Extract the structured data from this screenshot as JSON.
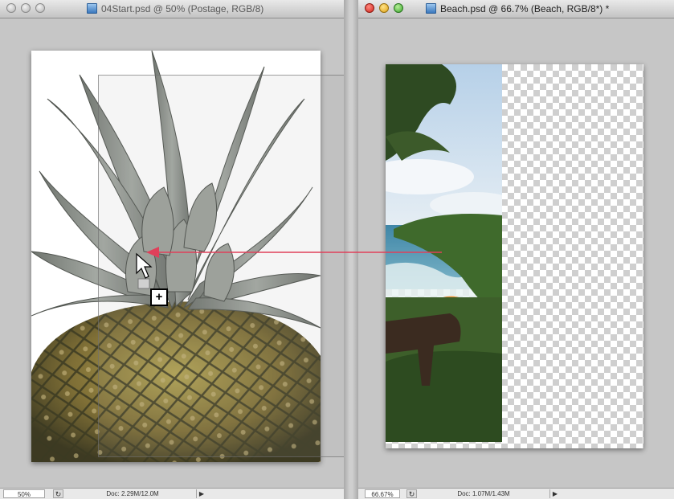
{
  "windows": {
    "left": {
      "title": "04Start.psd @ 50% (Postage, RGB/8)",
      "status": {
        "zoom": "50%",
        "doc": "Doc: 2.29M/12.0M"
      }
    },
    "right": {
      "title": "Beach.psd @ 66.7% (Beach, RGB/8*) *",
      "status": {
        "zoom": "66.67%",
        "doc": "Doc: 1.07M/1.43M"
      }
    }
  },
  "drag": {
    "plus_badge": "+"
  },
  "colors": {
    "drag_arrow": "#e0405a",
    "pine_leaf": "#8f948d",
    "pine_fruit": "#8a7a3a",
    "sky": "#c9dbeb",
    "sea": "#4f94b1"
  },
  "icons": [
    "doc-file-icon",
    "status-menu-arrow-icon",
    "hand-cursor-icon",
    "plus-icon"
  ]
}
